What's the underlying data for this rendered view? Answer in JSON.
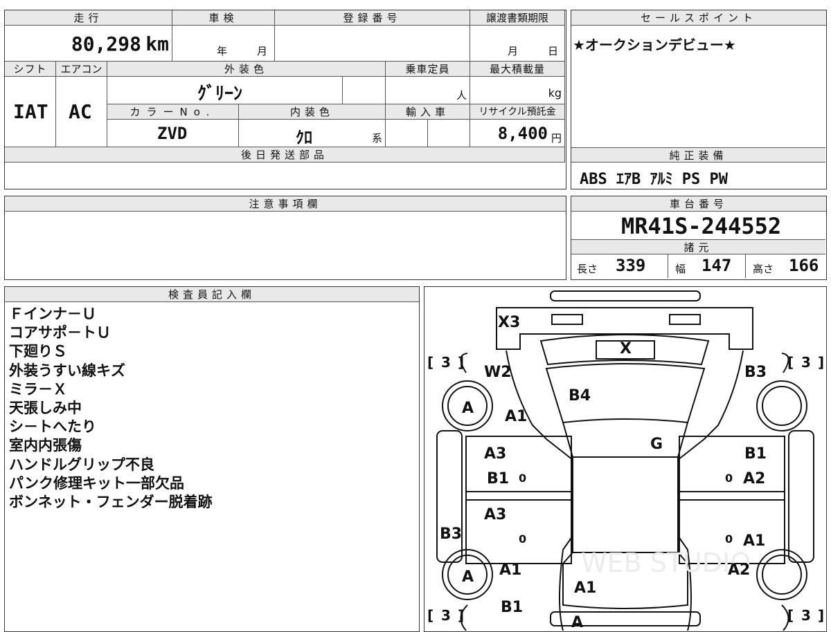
{
  "top_table": {
    "headers": {
      "mileage": "走行",
      "inspection": "車検",
      "registration": "登録番号",
      "transfer_deadline": "譲渡書類期限",
      "shift": "シフト",
      "aircon": "エアコン",
      "exterior_color": "外装色",
      "capacity": "乗車定員",
      "max_load": "最大積載量",
      "color_no": "カラーNo.",
      "interior_color": "内装色",
      "import": "輸入車",
      "recycle": "リサイクル預託金",
      "later_parts": "後日発送部品"
    },
    "mileage_value": "80,298",
    "mileage_unit": "km",
    "year_unit": "年",
    "month_unit": "月",
    "day_unit": "日",
    "shift_value": "IAT",
    "aircon_value": "AC",
    "exterior_color_value": "ｸﾞﾘｰﾝ",
    "capacity_unit": "人",
    "max_load_unit": "kg",
    "color_no_value": "ZVD",
    "interior_color_value": "ｸﾛ",
    "interior_color_suffix": "系",
    "recycle_value": "8,400",
    "recycle_unit": "円"
  },
  "sales_point": {
    "header": "セールスポイント",
    "text": "★オークションデビュー★"
  },
  "standard_equipment": {
    "header": "純正装備",
    "text": "ABS ｴｱB ｱﾙﾐ PS PW"
  },
  "notes": {
    "header": "注意事項欄"
  },
  "chassis": {
    "header": "車台番号",
    "value": "MR41S-244552",
    "specs_header": "諸元",
    "length_label": "長さ",
    "length_value": "339",
    "width_label": "幅",
    "width_value": "147",
    "height_label": "高さ",
    "height_value": "166"
  },
  "inspector": {
    "header": "検査員記入欄",
    "lines": [
      "Ｆインナ－Ｕ",
      "コアサポ－トＵ",
      "下廻りＳ",
      "外装うすい線キズ",
      "ミラ－Ｘ",
      "天張しみ中",
      "シ－トへたり",
      "室内内張傷",
      "ハンドルグリップ不良",
      "パンク修理キット一部欠品",
      "ボンネット・フェンダー脱着跡"
    ]
  },
  "diagram": {
    "watermark": "WEB STUDIO",
    "marks": {
      "x3": "X3",
      "x": "X",
      "w2": "W2",
      "b4": "B4",
      "b3_tr": "B3",
      "a_fl": "A",
      "a1_fl": "A1",
      "g": "G",
      "a3_l1": "A3",
      "b1_l1": "B1",
      "b1_r1": "B1",
      "a2_r1": "A2",
      "a3_l2": "A3",
      "b3_l": "B3",
      "a1_r2": "A1",
      "a_rl": "A",
      "a1_rl": "A1",
      "a2_rr": "A2",
      "a1_c": "A1",
      "b1_bl": "B1",
      "a_bc": "A",
      "three": "3",
      "zero": "0"
    }
  }
}
